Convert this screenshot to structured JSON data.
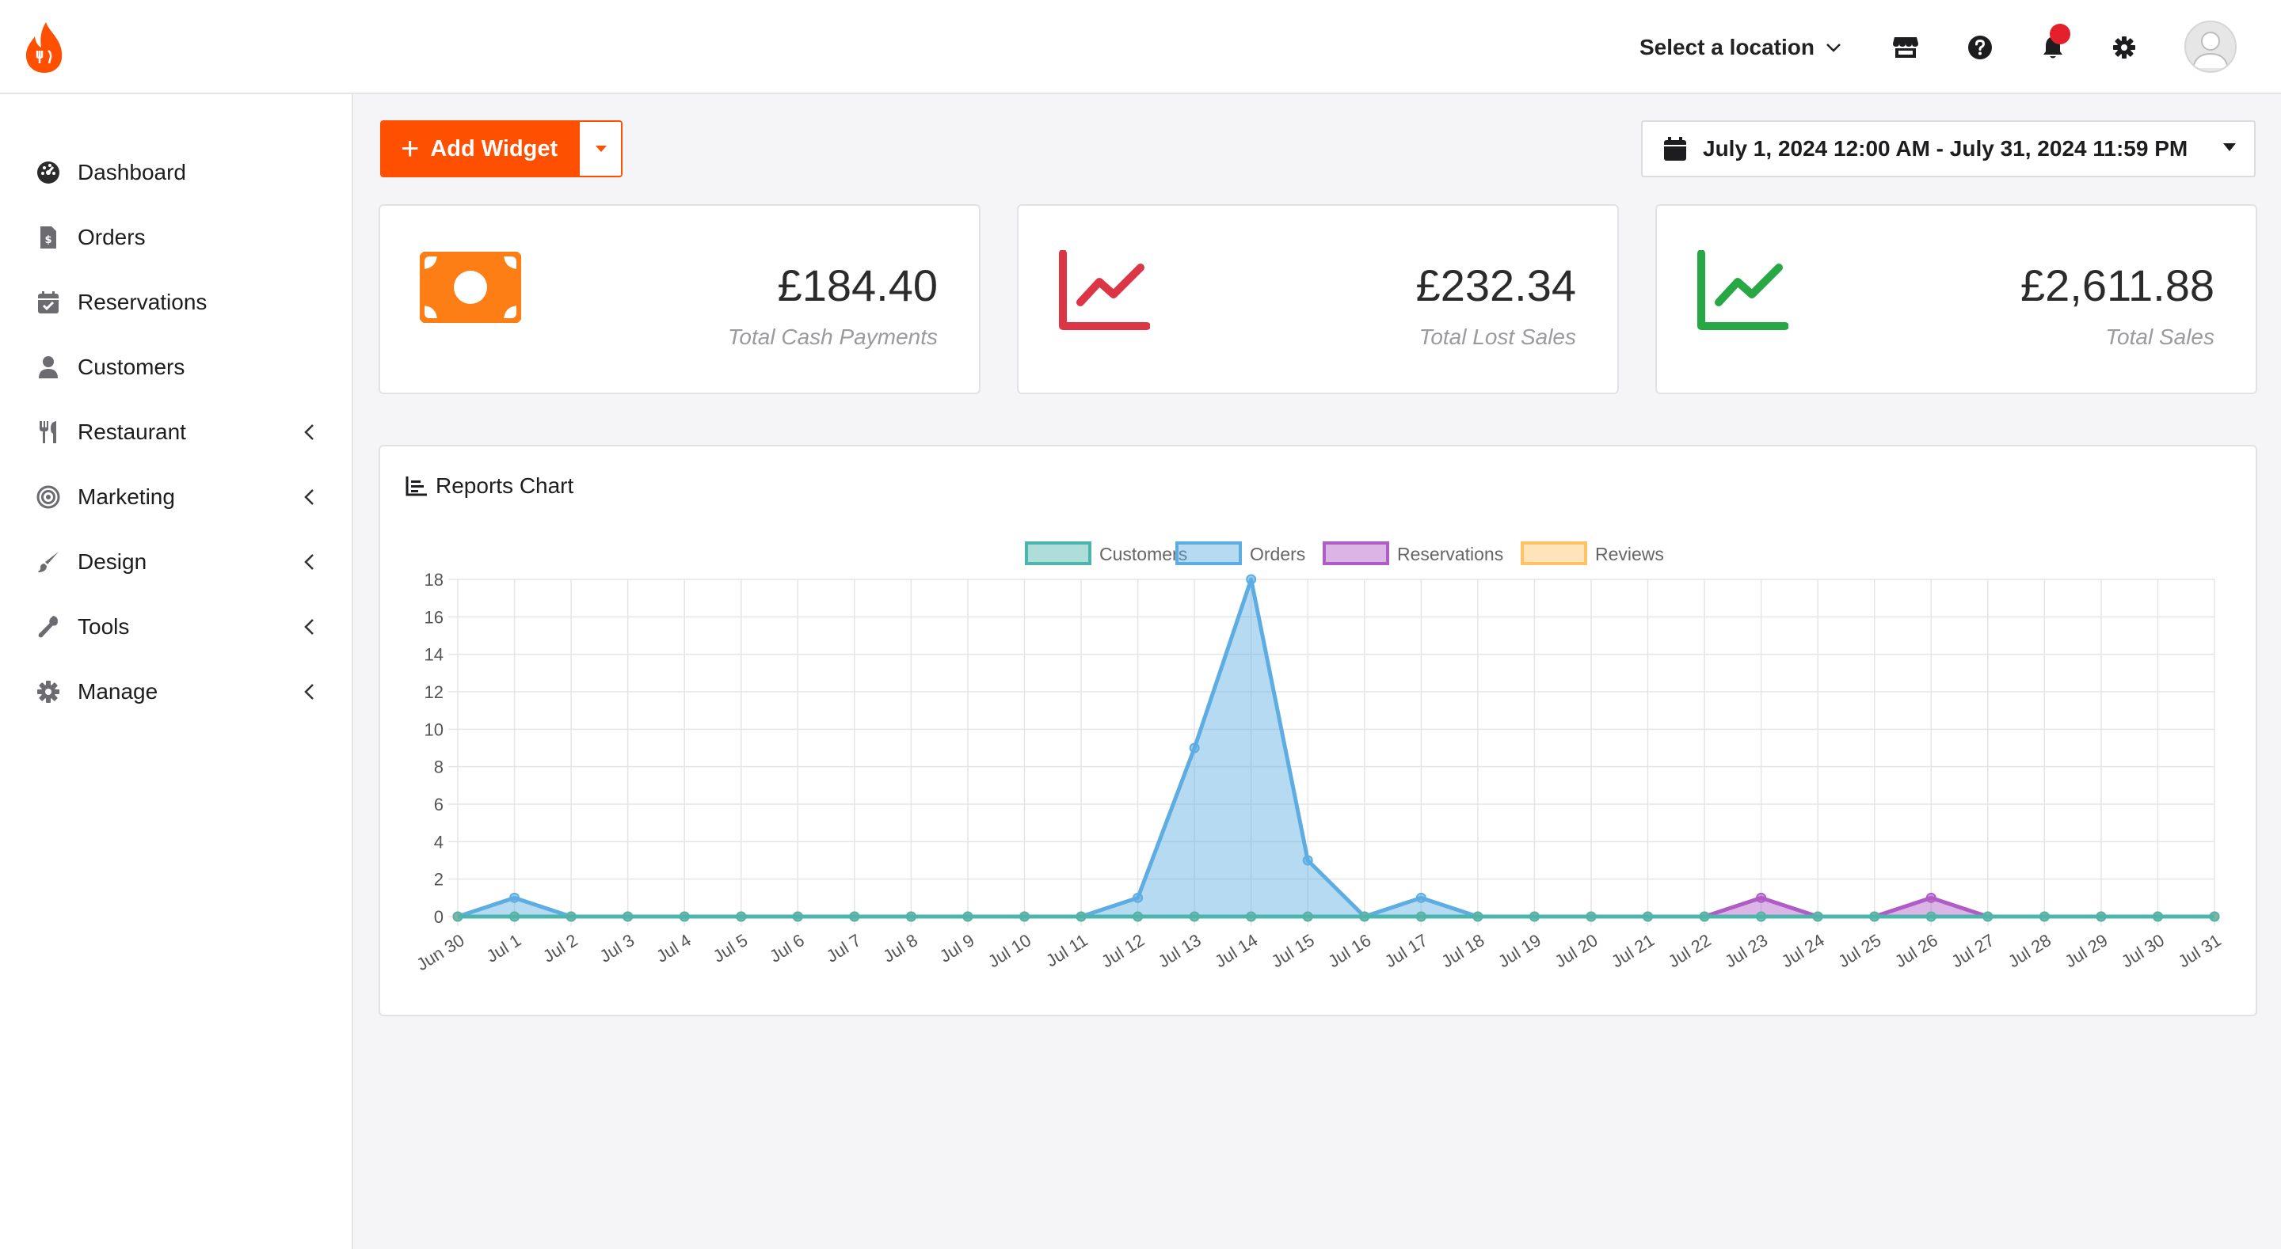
{
  "header": {
    "location_label": "Select a location",
    "icons": [
      "store-icon",
      "help-icon",
      "bell-icon",
      "gear-icon",
      "avatar-icon"
    ]
  },
  "sidebar": {
    "items": [
      {
        "label": "Dashboard",
        "icon": "dashboard-icon",
        "has_submenu": false
      },
      {
        "label": "Orders",
        "icon": "orders-icon",
        "has_submenu": false
      },
      {
        "label": "Reservations",
        "icon": "calendar-icon",
        "has_submenu": false
      },
      {
        "label": "Customers",
        "icon": "user-icon",
        "has_submenu": false
      },
      {
        "label": "Restaurant",
        "icon": "utensils-icon",
        "has_submenu": true
      },
      {
        "label": "Marketing",
        "icon": "target-icon",
        "has_submenu": true
      },
      {
        "label": "Design",
        "icon": "brush-icon",
        "has_submenu": true
      },
      {
        "label": "Tools",
        "icon": "wrench-icon",
        "has_submenu": true
      },
      {
        "label": "Manage",
        "icon": "gear-icon",
        "has_submenu": true
      }
    ]
  },
  "toolbar": {
    "add_widget_label": "Add Widget",
    "date_range": "July 1, 2024 12:00 AM - July 31, 2024 11:59 PM"
  },
  "cards": [
    {
      "value": "£184.40",
      "caption": "Total Cash Payments",
      "icon": "money-bill-icon",
      "color": "#fd7e14"
    },
    {
      "value": "£232.34",
      "caption": "Total Lost Sales",
      "icon": "line-chart-icon",
      "color": "#dc3545"
    },
    {
      "value": "£2,611.88",
      "caption": "Total Sales",
      "icon": "line-chart-icon",
      "color": "#28a745"
    }
  ],
  "chart": {
    "title": "Reports Chart"
  },
  "chart_data": {
    "type": "area",
    "title": "Reports Chart",
    "categories": [
      "Jun 30",
      "Jul 1",
      "Jul 2",
      "Jul 3",
      "Jul 4",
      "Jul 5",
      "Jul 6",
      "Jul 7",
      "Jul 8",
      "Jul 9",
      "Jul 10",
      "Jul 11",
      "Jul 12",
      "Jul 13",
      "Jul 14",
      "Jul 15",
      "Jul 16",
      "Jul 17",
      "Jul 18",
      "Jul 19",
      "Jul 20",
      "Jul 21",
      "Jul 22",
      "Jul 23",
      "Jul 24",
      "Jul 25",
      "Jul 26",
      "Jul 27",
      "Jul 28",
      "Jul 29",
      "Jul 30",
      "Jul 31"
    ],
    "series": [
      {
        "name": "Customers",
        "color": "#4db6ac",
        "values": [
          0,
          0,
          0,
          0,
          0,
          0,
          0,
          0,
          0,
          0,
          0,
          0,
          0,
          0,
          0,
          0,
          0,
          0,
          0,
          0,
          0,
          0,
          0,
          0,
          0,
          0,
          0,
          0,
          0,
          0,
          0,
          0
        ]
      },
      {
        "name": "Orders",
        "color": "#5dade2",
        "values": [
          0,
          1,
          0,
          0,
          0,
          0,
          0,
          0,
          0,
          0,
          0,
          0,
          1,
          9,
          18,
          3,
          0,
          1,
          0,
          0,
          0,
          0,
          0,
          0,
          0,
          0,
          0,
          0,
          0,
          0,
          0,
          0
        ]
      },
      {
        "name": "Reservations",
        "color": "#b05cc6",
        "values": [
          0,
          0,
          0,
          0,
          0,
          0,
          0,
          0,
          0,
          0,
          0,
          0,
          0,
          0,
          0,
          0,
          0,
          0,
          0,
          0,
          0,
          0,
          0,
          1,
          0,
          0,
          1,
          0,
          0,
          0,
          0,
          0
        ]
      },
      {
        "name": "Reviews",
        "color": "#ffc266",
        "values": [
          0,
          0,
          0,
          0,
          0,
          0,
          0,
          0,
          0,
          0,
          0,
          0,
          0,
          0,
          0,
          0,
          0,
          0,
          0,
          0,
          0,
          0,
          0,
          0,
          0,
          0,
          0,
          0,
          0,
          0,
          0,
          0
        ]
      }
    ],
    "ylim": [
      0,
      18
    ],
    "yticks": [
      0,
      2,
      4,
      6,
      8,
      10,
      12,
      14,
      16,
      18
    ],
    "grid": true,
    "legend": "top"
  }
}
